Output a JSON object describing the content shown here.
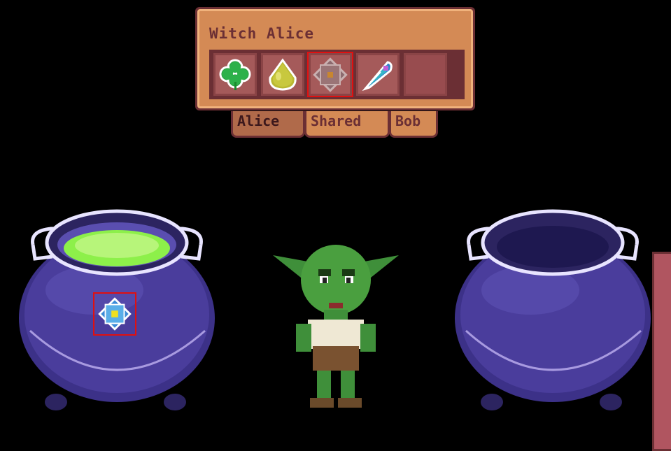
{
  "panel": {
    "title": "Witch Alice",
    "slots": [
      {
        "item": "clover-icon",
        "selected": false
      },
      {
        "item": "slime-drop-icon",
        "selected": false
      },
      {
        "item": "rune-crystal-icon",
        "selected": true
      },
      {
        "item": "feather-icon",
        "selected": false
      },
      {
        "item": "empty",
        "selected": false
      }
    ]
  },
  "tabs": [
    {
      "label": "Alice",
      "active": true
    },
    {
      "label": "Shared",
      "active": false
    },
    {
      "label": "Bob",
      "active": false
    }
  ],
  "scene": {
    "left_cauldron": {
      "content": "green potion",
      "ingredient": "rune-crystal-icon"
    },
    "right_cauldron": {
      "content": "empty"
    },
    "character": "goblin"
  },
  "colors": {
    "panel_border": "#6b2f34",
    "panel_fill": "#d48a55",
    "cauldron": "#4a3a9c",
    "potion": "#8df04a",
    "selection": "#e01010"
  }
}
